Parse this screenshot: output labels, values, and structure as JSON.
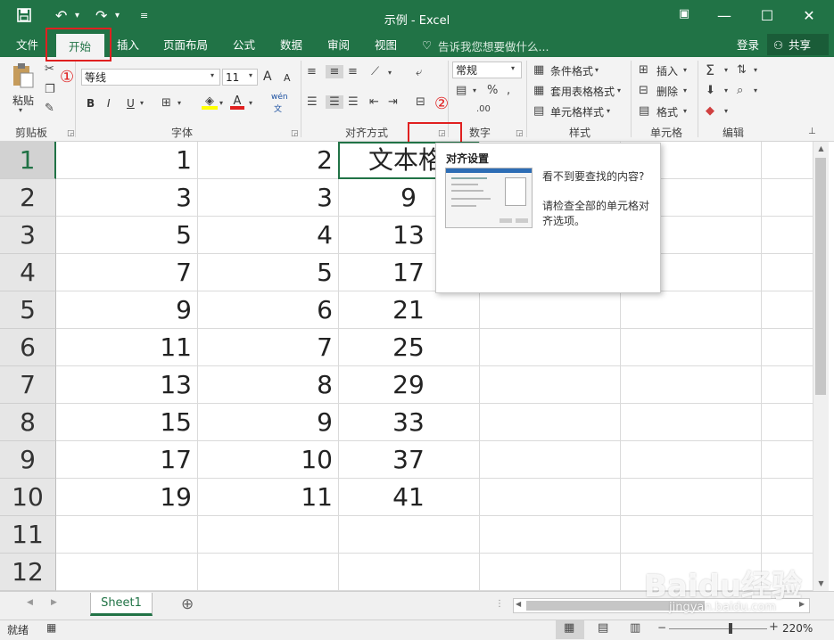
{
  "window": {
    "title": "示例 - Excel",
    "qat": {
      "save_icon": "save-icon",
      "undo_icon": "undo-icon",
      "redo_icon": "redo-icon",
      "customize_icon": "customize-qat-icon"
    },
    "controls": {
      "ribbon_display": "ribbon-display-icon",
      "minimize": "—",
      "maximize": "☐",
      "close": "✕"
    }
  },
  "tabs": [
    {
      "label": "文件"
    },
    {
      "label": "开始",
      "active": true
    },
    {
      "label": "插入"
    },
    {
      "label": "页面布局"
    },
    {
      "label": "公式"
    },
    {
      "label": "数据"
    },
    {
      "label": "审阅"
    },
    {
      "label": "视图"
    }
  ],
  "tellme": "告诉我您想要做什么...",
  "signin": "登录",
  "share": "共享",
  "ribbon": {
    "clipboard": {
      "label": "剪贴板",
      "paste": "粘贴"
    },
    "font": {
      "label": "字体",
      "font_name": "等线",
      "font_size": "11",
      "bold": "B",
      "italic": "I",
      "underline": "U",
      "grow": "A",
      "shrink": "A",
      "phonetic_top": "wén",
      "phonetic_bottom": "文"
    },
    "alignment": {
      "label": "对齐方式"
    },
    "number": {
      "label": "数字",
      "format": "常规"
    },
    "styles": {
      "label": "样式",
      "conditional": "条件格式",
      "table": "套用表格格式",
      "cell_styles": "单元格样式"
    },
    "cells": {
      "label": "单元格",
      "insert": "插入",
      "delete": "删除",
      "format": "格式"
    },
    "editing": {
      "label": "编辑"
    }
  },
  "annotations": {
    "one": "1",
    "two": "2"
  },
  "colors": {
    "accent": "#217346",
    "annotation": "#e02020"
  },
  "grid": {
    "rows": [
      {
        "num": "1",
        "a": "1",
        "b": "2",
        "c": "文本格"
      },
      {
        "num": "2",
        "a": "3",
        "b": "3",
        "c": "9"
      },
      {
        "num": "3",
        "a": "5",
        "b": "4",
        "c": "13"
      },
      {
        "num": "4",
        "a": "7",
        "b": "5",
        "c": "17"
      },
      {
        "num": "5",
        "a": "9",
        "b": "6",
        "c": "21"
      },
      {
        "num": "6",
        "a": "11",
        "b": "7",
        "c": "25"
      },
      {
        "num": "7",
        "a": "13",
        "b": "8",
        "c": "29"
      },
      {
        "num": "8",
        "a": "15",
        "b": "9",
        "c": "33"
      },
      {
        "num": "9",
        "a": "17",
        "b": "10",
        "c": "37"
      },
      {
        "num": "10",
        "a": "19",
        "b": "11",
        "c": "41"
      },
      {
        "num": "11",
        "a": "",
        "b": "",
        "c": ""
      },
      {
        "num": "12",
        "a": "",
        "b": "",
        "c": ""
      }
    ]
  },
  "tooltip": {
    "title": "对齐设置",
    "line1": "看不到要查找的内容?",
    "line2": "请检查全部的单元格对齐选项。"
  },
  "sheet_tab": "Sheet1",
  "add_sheet": "⊕",
  "status": {
    "ready": "就绪",
    "zoom": "220%"
  },
  "watermark": {
    "logo": "Baidu经验",
    "url": "jingyan.baidu.com"
  }
}
